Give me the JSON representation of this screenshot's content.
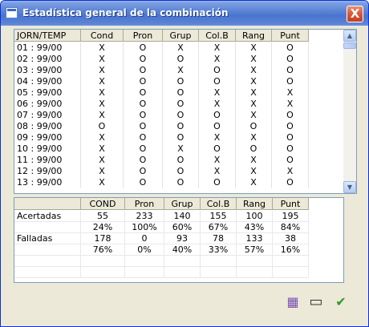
{
  "window": {
    "title": "Estadística general de la combinación",
    "close_label": "X"
  },
  "results_table": {
    "headers": [
      "JORN/TEMP",
      "Cond",
      "Pron",
      "Grup",
      "Col.B",
      "Rang",
      "Punt"
    ],
    "rows": [
      [
        "01 : 99/00",
        "X",
        "O",
        "X",
        "X",
        "X",
        "O"
      ],
      [
        "02 : 99/00",
        "X",
        "O",
        "O",
        "X",
        "X",
        "O"
      ],
      [
        "03 : 99/00",
        "X",
        "O",
        "X",
        "O",
        "X",
        "O"
      ],
      [
        "04 : 99/00",
        "X",
        "O",
        "O",
        "O",
        "X",
        "O"
      ],
      [
        "05 : 99/00",
        "X",
        "O",
        "O",
        "X",
        "X",
        "X"
      ],
      [
        "06 : 99/00",
        "X",
        "O",
        "O",
        "X",
        "X",
        "X"
      ],
      [
        "07 : 99/00",
        "X",
        "O",
        "O",
        "O",
        "X",
        "O"
      ],
      [
        "08 : 99/00",
        "O",
        "O",
        "O",
        "O",
        "O",
        "O"
      ],
      [
        "09 : 99/00",
        "X",
        "O",
        "O",
        "X",
        "X",
        "O"
      ],
      [
        "10 : 99/00",
        "X",
        "O",
        "X",
        "O",
        "O",
        "O"
      ],
      [
        "11 : 99/00",
        "X",
        "O",
        "O",
        "X",
        "X",
        "O"
      ],
      [
        "12 : 99/00",
        "X",
        "O",
        "O",
        "X",
        "X",
        "X"
      ],
      [
        "13 : 99/00",
        "X",
        "O",
        "O",
        "O",
        "X",
        "O"
      ]
    ]
  },
  "summary_table": {
    "headers": [
      "",
      "COND",
      "Pron",
      "Grup",
      "Col.B",
      "Rang",
      "Punt"
    ],
    "rows": [
      [
        "Acertadas",
        "55",
        "233",
        "140",
        "155",
        "100",
        "195"
      ],
      [
        "",
        "24%",
        "100%",
        "60%",
        "67%",
        "43%",
        "84%"
      ],
      [
        "Falladas",
        "178",
        "0",
        "93",
        "78",
        "133",
        "38"
      ],
      [
        "",
        "76%",
        "0%",
        "40%",
        "33%",
        "57%",
        "16%"
      ],
      [
        "",
        "",
        "",
        "",
        "",
        "",
        ""
      ],
      [
        "",
        "",
        "",
        "",
        "",
        "",
        ""
      ]
    ]
  },
  "toolbar": {
    "icons": [
      "calendar-icon",
      "window-icon",
      "checkmark-icon"
    ],
    "calendar_glyph": "▦",
    "window_glyph": "▭",
    "check_glyph": "✔"
  },
  "colors": {
    "titlebar": "#4a75cf",
    "window_bg": "#ece9d8",
    "check": "#2e9a27",
    "calendar": "#7a4fb2"
  }
}
